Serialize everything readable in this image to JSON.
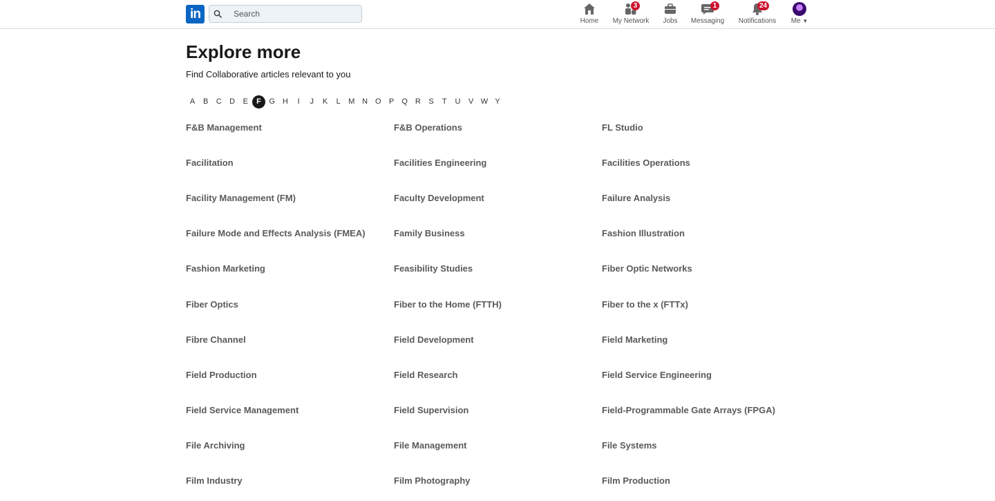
{
  "nav": {
    "logo_text": "in",
    "search_placeholder": "Search",
    "items": [
      {
        "label": "Home",
        "badge": ""
      },
      {
        "label": "My Network",
        "badge": "3"
      },
      {
        "label": "Jobs",
        "badge": ""
      },
      {
        "label": "Messaging",
        "badge": "1"
      },
      {
        "label": "Notifications",
        "badge": "24"
      },
      {
        "label": "Me",
        "badge": ""
      }
    ]
  },
  "page": {
    "title": "Explore more",
    "subtitle": "Find Collaborative articles relevant to you"
  },
  "alphabet": {
    "letters": [
      "A",
      "B",
      "C",
      "D",
      "E",
      "F",
      "G",
      "H",
      "I",
      "J",
      "K",
      "L",
      "M",
      "N",
      "O",
      "P",
      "Q",
      "R",
      "S",
      "T",
      "U",
      "V",
      "W",
      "Y"
    ],
    "active": "F"
  },
  "topics": [
    "F&B Management",
    "F&B Operations",
    "FL Studio",
    "Facilitation",
    "Facilities Engineering",
    "Facilities Operations",
    "Facility Management (FM)",
    "Faculty Development",
    "Failure Analysis",
    "Failure Mode and Effects Analysis (FMEA)",
    "Family Business",
    "Fashion Illustration",
    "Fashion Marketing",
    "Feasibility Studies",
    "Fiber Optic Networks",
    "Fiber Optics",
    "Fiber to the Home (FTTH)",
    "Fiber to the x (FTTx)",
    "Fibre Channel",
    "Field Development",
    "Field Marketing",
    "Field Production",
    "Field Research",
    "Field Service Engineering",
    "Field Service Management",
    "Field Supervision",
    "Field-Programmable Gate Arrays (FPGA)",
    "File Archiving",
    "File Management",
    "File Systems",
    "Film Industry",
    "Film Photography",
    "Film Production"
  ],
  "colors": {
    "brand": "#0a66c2",
    "badge": "#cb112d",
    "active_letter_bg": "#191919",
    "topic_text": "#5a5a5a"
  },
  "icons": {
    "home": "home-icon",
    "network": "my-network-icon",
    "jobs": "briefcase-icon",
    "messaging": "chat-bubble-icon",
    "notifications": "bell-icon",
    "search": "search-icon"
  }
}
